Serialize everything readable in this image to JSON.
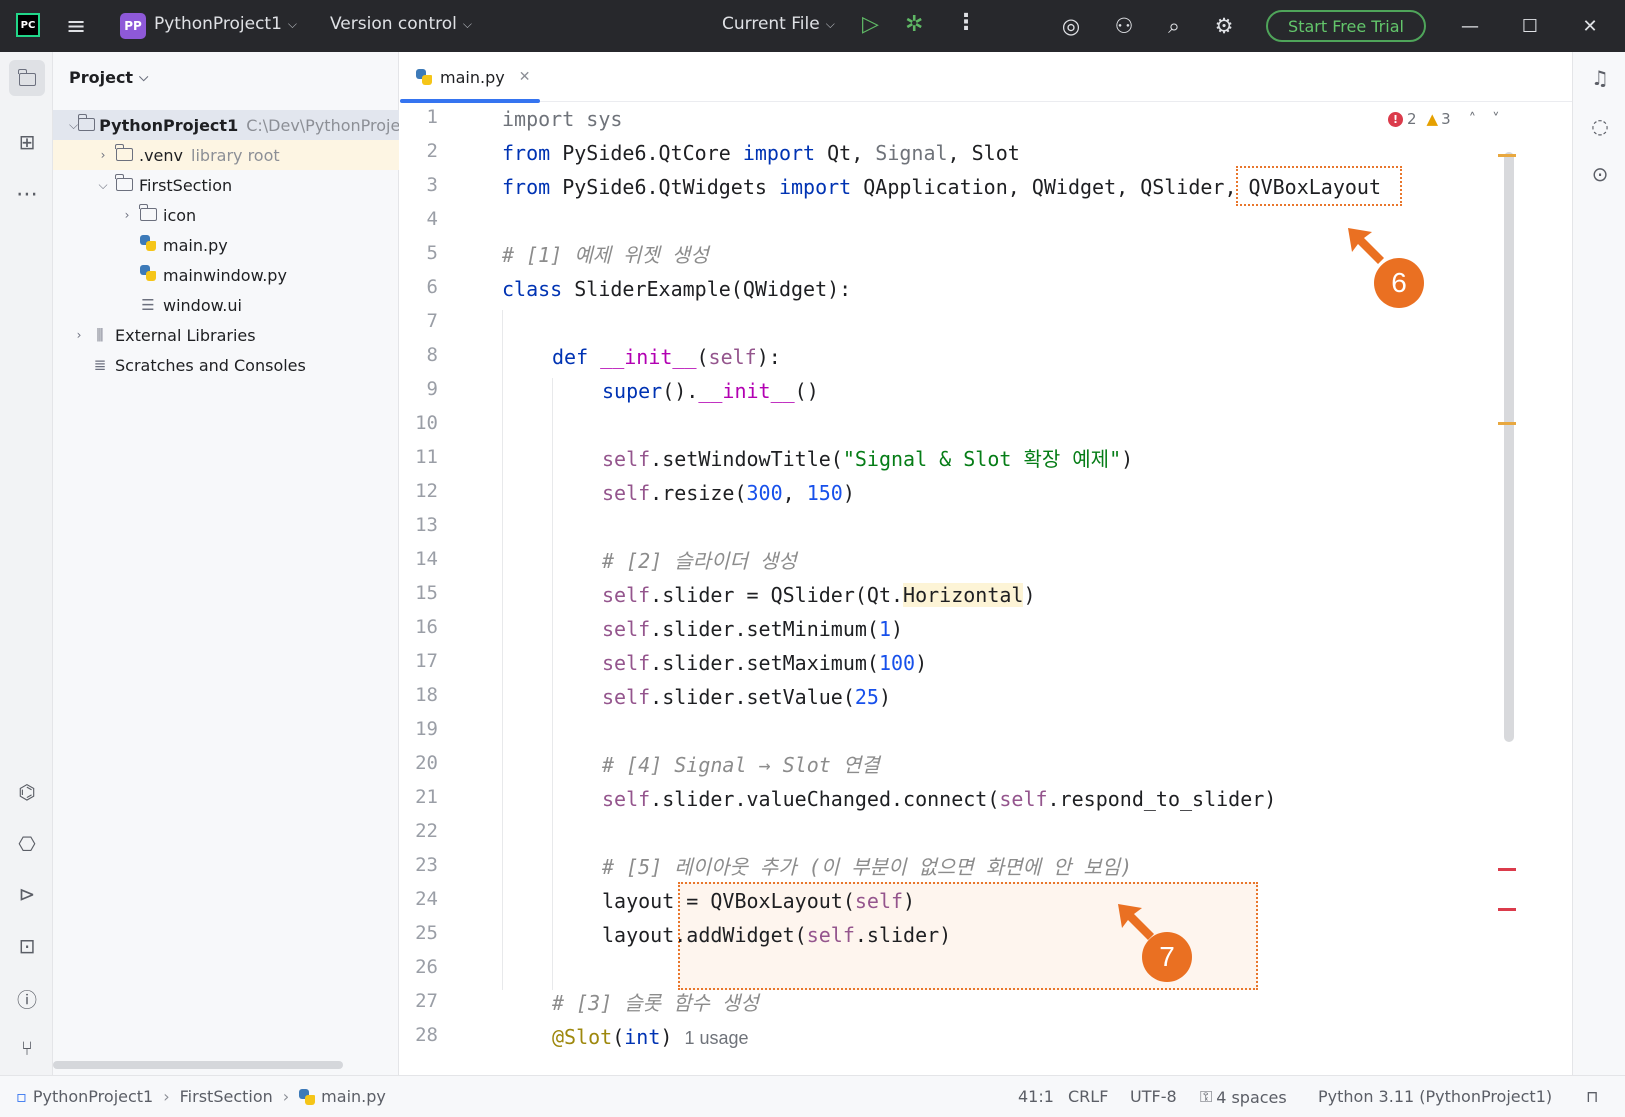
{
  "titlebar": {
    "logo_text": "PC",
    "project_badge": "PP",
    "project_name": "PythonProject1",
    "vcs_label": "Version control",
    "run_config": "Current File",
    "trial_label": "Start Free Trial"
  },
  "project_panel": {
    "title": "Project",
    "tree": [
      {
        "label": "PythonProject1",
        "hint": "C:\\Dev\\PythonProject1"
      },
      {
        "label": ".venv",
        "hint": "library root"
      },
      {
        "label": "FirstSection"
      },
      {
        "label": "icon"
      },
      {
        "label": "main.py"
      },
      {
        "label": "mainwindow.py"
      },
      {
        "label": "window.ui"
      },
      {
        "label": "External Libraries"
      },
      {
        "label": "Scratches and Consoles"
      }
    ]
  },
  "editor": {
    "tab_label": "main.py",
    "inspections": {
      "errors": "2",
      "warnings": "3"
    },
    "line_numbers": [
      "1",
      "2",
      "3",
      "4",
      "5",
      "6",
      "7",
      "8",
      "9",
      "10",
      "11",
      "12",
      "13",
      "14",
      "15",
      "16",
      "17",
      "18",
      "19",
      "20",
      "21",
      "22",
      "23",
      "24",
      "25",
      "26",
      "27",
      "28"
    ],
    "code": {
      "l1_import": "import",
      "l1_sys": " sys",
      "l2_from": "from",
      "l2_mod": " PySide6.QtCore ",
      "l2_import": "import",
      "l2_qt": " Qt, ",
      "l2_signal": "Signal",
      "l2_slot": ", Slot",
      "l3_from": "from",
      "l3_mod": " PySide6.QtWidgets ",
      "l3_import": "import",
      "l3_names": " QApplication, QWidget, QSlider, QVBoxLayout",
      "l5": "# [1] 예제 위젯 생성",
      "l6_class": "class",
      "l6_rest": " SliderExample(QWidget):",
      "l8_def": "def",
      "l8_name": " __init__",
      "l8_open": "(",
      "l8_self": "self",
      "l8_close": "):",
      "l9_super": "super",
      "l9_mid": "().",
      "l9_init": "__init__",
      "l9_end": "()",
      "l11_self": "self",
      "l11_call": ".setWindowTitle(",
      "l11_str": "\"Signal & Slot 확장 예제\"",
      "l11_end": ")",
      "l12_self": "self",
      "l12_call": ".resize(",
      "l12_n1": "300",
      "l12_comma": ", ",
      "l12_n2": "150",
      "l12_end": ")",
      "l14": "# [2] 슬라이더 생성",
      "l15_self": "self",
      "l15_call": ".slider = QSlider(Qt.",
      "l15_hl": "Horizontal",
      "l15_end": ")",
      "l16_self": "self",
      "l16_call": ".slider.setMinimum(",
      "l16_n": "1",
      "l16_end": ")",
      "l17_self": "self",
      "l17_call": ".slider.setMaximum(",
      "l17_n": "100",
      "l17_end": ")",
      "l18_self": "self",
      "l18_call": ".slider.setValue(",
      "l18_n": "25",
      "l18_end": ")",
      "l20": "# [4] Signal → Slot 연결",
      "l21_self": "self",
      "l21_call": ".slider.valueChanged.connect(",
      "l21_self2": "self",
      "l21_end": ".respond_to_slider)",
      "l23": "# [5] 레이아웃 추가 (이 부분이 없으면 화면에 안 보임)",
      "l24_a": "layout = QVBoxLayout(",
      "l24_self": "self",
      "l24_end": ")",
      "l25_a": "layout.addWidget(",
      "l25_self": "self",
      "l25_end": ".slider)",
      "l27": "# [3] 슬롯 함수 생성",
      "l28_dec": "@Slot",
      "l28_open": "(",
      "l28_int": "int",
      "l28_close": ")",
      "l28_usage": "1 usage"
    },
    "callouts": {
      "c6": "6",
      "c7": "7"
    }
  },
  "statusbar": {
    "breadcrumb": [
      "PythonProject1",
      "FirstSection",
      "main.py"
    ],
    "position": "41:1",
    "line_sep": "CRLF",
    "encoding": "UTF-8",
    "indent": "4 spaces",
    "interpreter": "Python 3.11 (PythonProject1)"
  },
  "colors": {
    "accent": "#3574f0",
    "callout": "#ea7022",
    "keyword": "#0033b3",
    "self": "#94558d",
    "number": "#1750eb",
    "string": "#067d17",
    "comment": "#8c8c8c"
  }
}
